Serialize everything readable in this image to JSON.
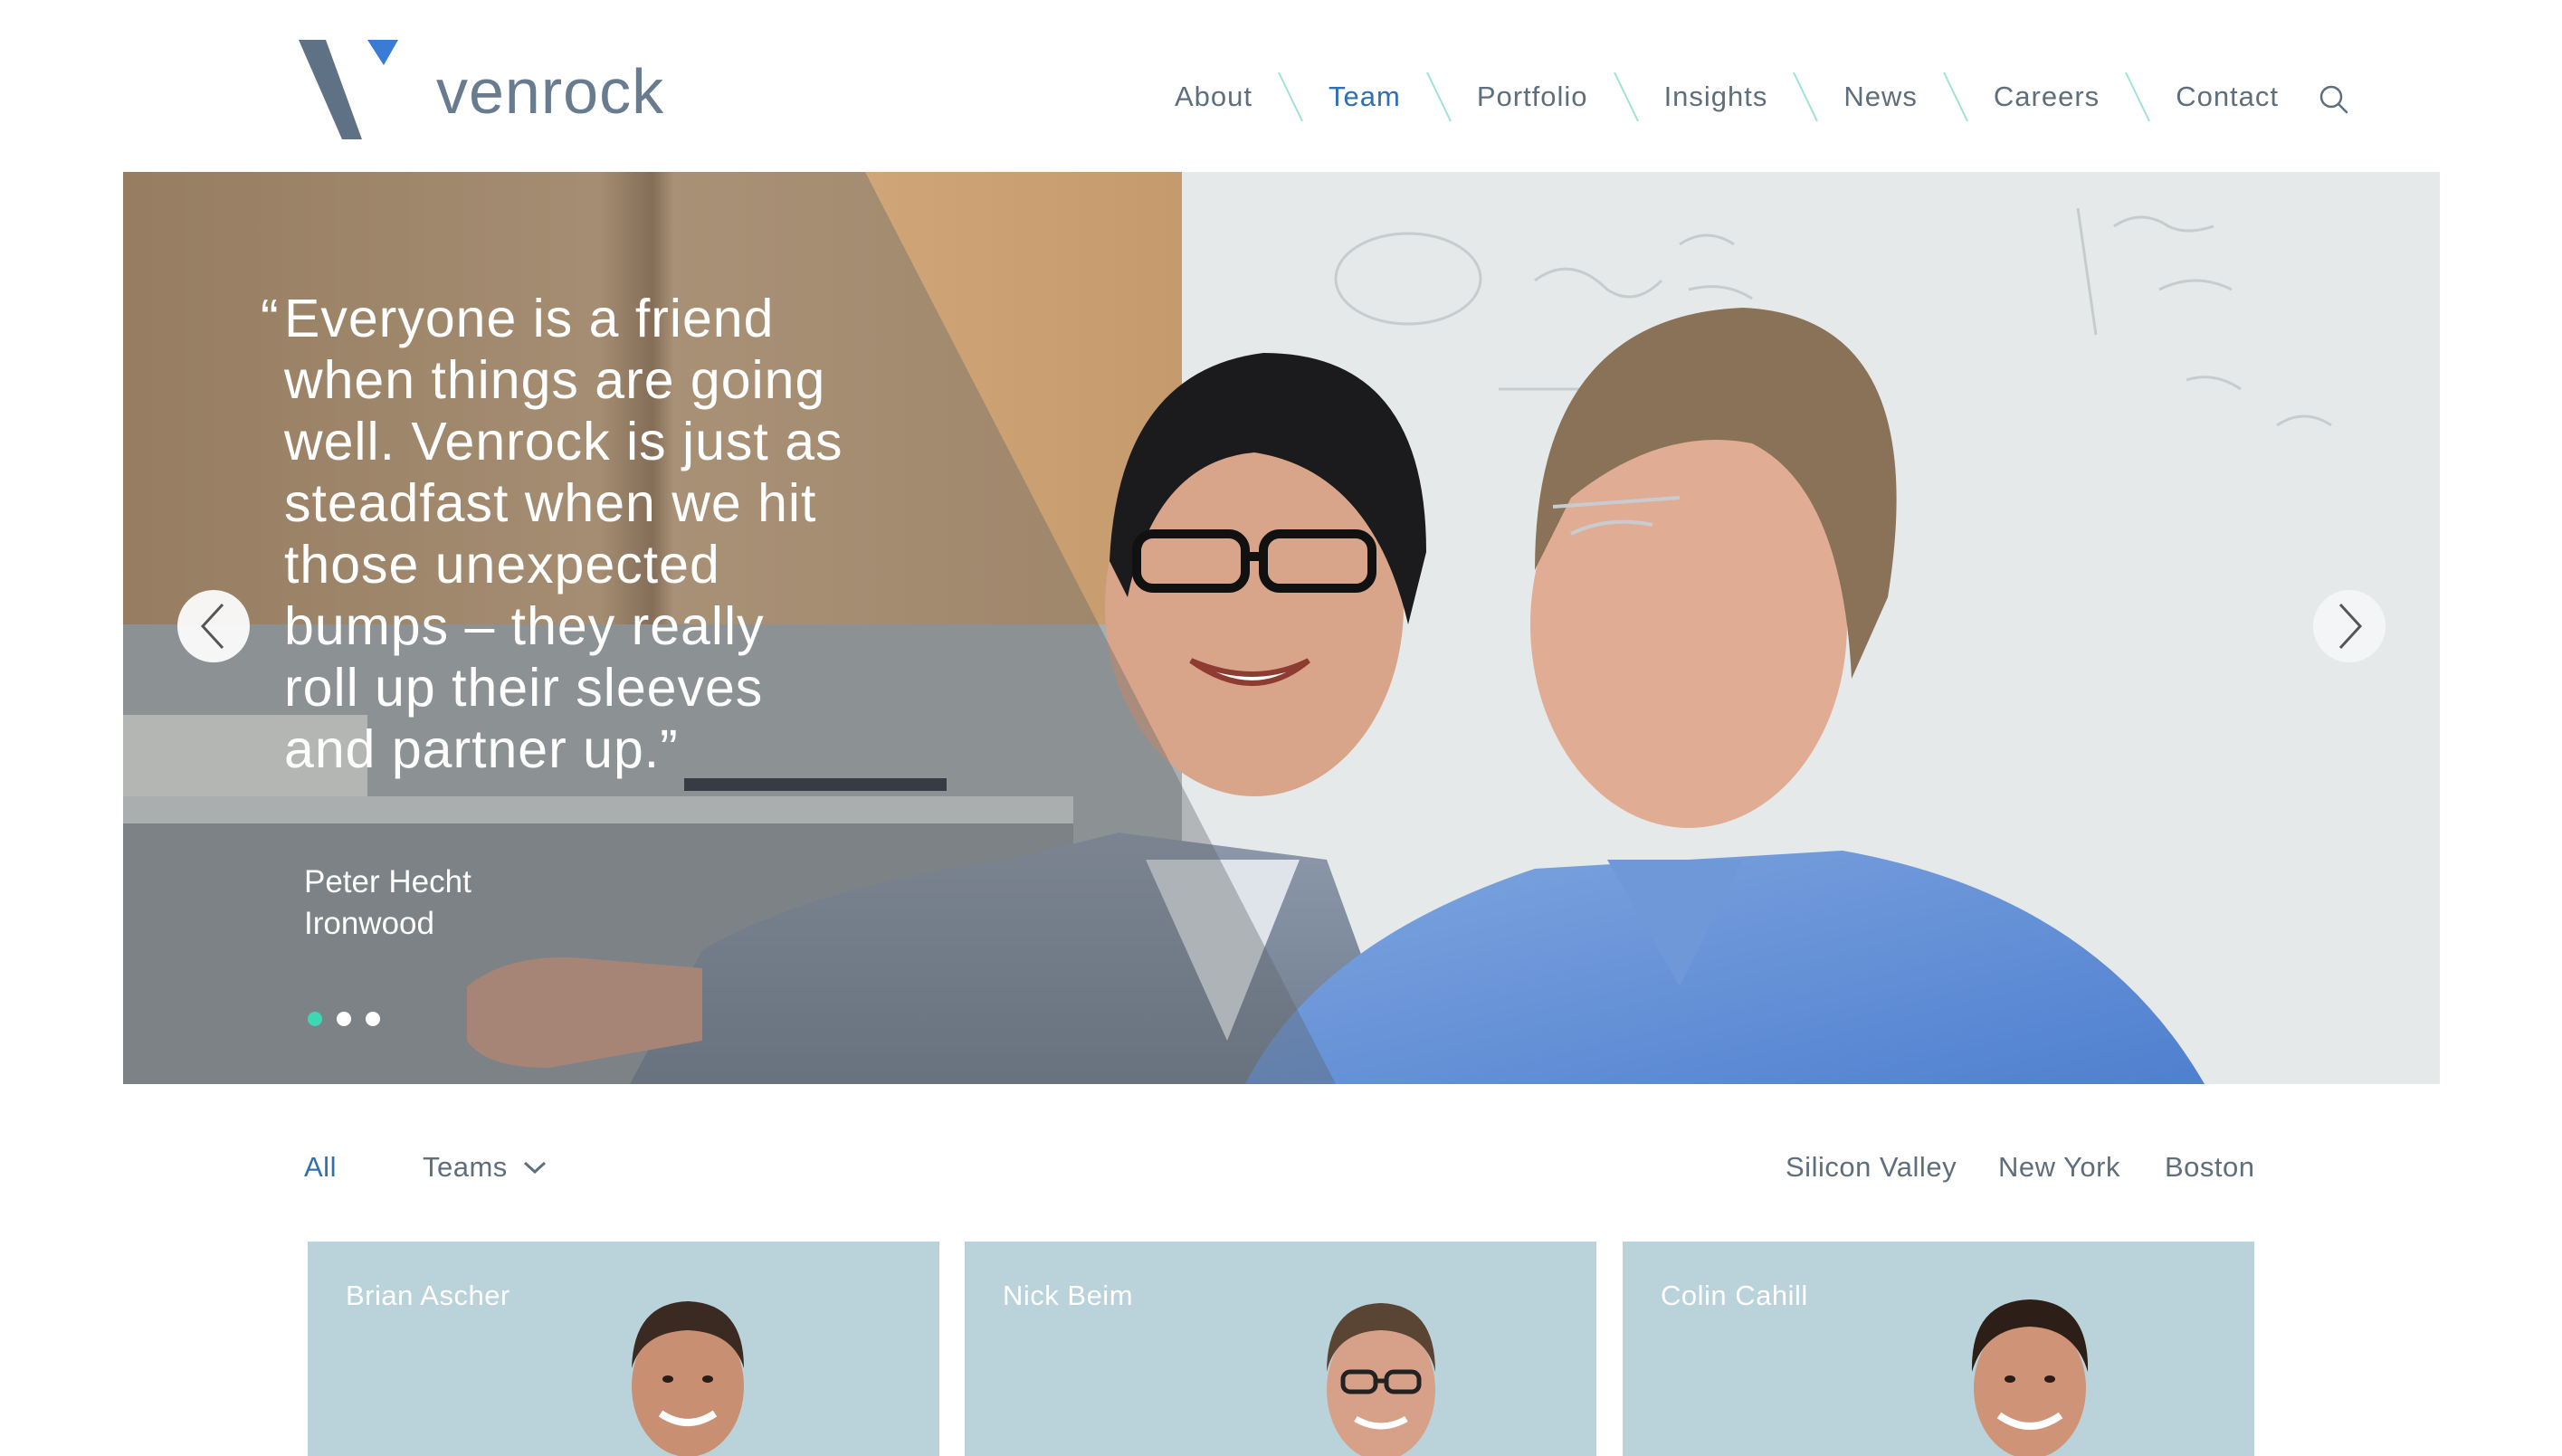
{
  "brand": {
    "name": "venrock",
    "accent_color": "#3a7bd5",
    "logo_color": "#5f7285"
  },
  "nav": {
    "items": [
      {
        "label": "About",
        "active": false
      },
      {
        "label": "Team",
        "active": true
      },
      {
        "label": "Portfolio",
        "active": false
      },
      {
        "label": "Insights",
        "active": false
      },
      {
        "label": "News",
        "active": false
      },
      {
        "label": "Careers",
        "active": false
      },
      {
        "label": "Contact",
        "active": false
      }
    ],
    "search_icon": "search-icon",
    "separator_color": "#9ee3d6"
  },
  "hero": {
    "quote_open": "“",
    "quote_lines": [
      "Everyone is a friend",
      "when things are going",
      "well. Venrock is just as",
      "steadfast when we hit",
      "those unexpected",
      "bumps – they really",
      "roll up their sleeves",
      "and partner up.”"
    ],
    "person": "Peter Hecht",
    "company": "Ironwood",
    "slide_count": 3,
    "active_slide": 0,
    "prev_icon": "chevron-left-icon",
    "next_icon": "chevron-right-icon",
    "active_dot_color": "#3fd6b4"
  },
  "filters": {
    "all": "All",
    "teams": "Teams",
    "teams_icon": "chevron-down-icon",
    "locations": [
      "Silicon Valley",
      "New York",
      "Boston"
    ]
  },
  "team": [
    {
      "name": "Brian Ascher"
    },
    {
      "name": "Nick Beim"
    },
    {
      "name": "Colin Cahill"
    }
  ]
}
